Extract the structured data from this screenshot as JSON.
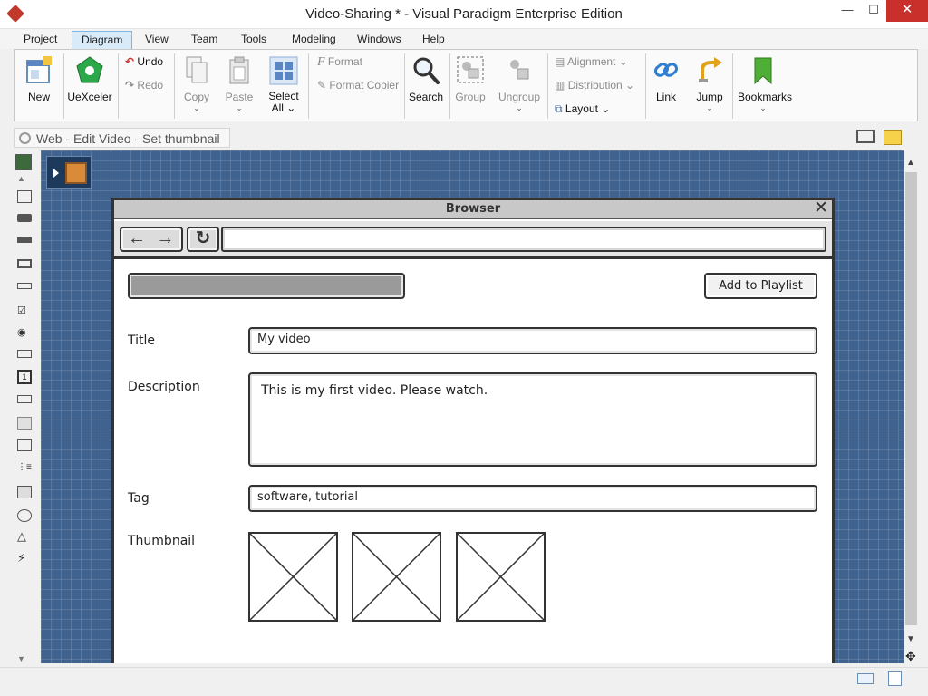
{
  "window": {
    "title": "Video-Sharing * - Visual Paradigm Enterprise Edition",
    "min_symbol": "—",
    "max_symbol": "☐",
    "close_symbol": "✕"
  },
  "menu": {
    "tabs": [
      "Project",
      "Diagram",
      "View",
      "Team",
      "Tools",
      "Modeling",
      "Windows",
      "Help"
    ],
    "active": "Diagram"
  },
  "ribbon": {
    "new": "New",
    "uexceler": "UeXceler",
    "undo": "Undo",
    "redo": "Redo",
    "copy": "Copy",
    "paste": "Paste",
    "select_all_1": "Select",
    "select_all_2": "All",
    "format": "Format",
    "format_copier": "Format Copier",
    "search": "Search",
    "group": "Group",
    "ungroup": "Ungroup",
    "alignment": "Alignment",
    "distribution": "Distribution",
    "layout": "Layout",
    "link": "Link",
    "jump": "Jump",
    "bookmarks": "Bookmarks"
  },
  "breadcrumb": {
    "label": "Web - Edit Video - Set thumbnail"
  },
  "wireframe": {
    "browser_title": "Browser",
    "add_button": "Add to Playlist",
    "title_label": "Title",
    "title_value": "My video",
    "description_label": "Description",
    "description_value": "This is my first video. Please watch.",
    "tag_label": "Tag",
    "tag_value": "software, tutorial",
    "thumbnail_label": "Thumbnail",
    "thumbnail_count": 3
  },
  "colors": {
    "canvas_bg": "#3f628f",
    "close_button": "#c9302c",
    "active_tab": "#d9ebf9"
  },
  "icons": [
    "app-logo-icon",
    "new-diagram-icon",
    "uexceler-icon",
    "undo-icon",
    "redo-icon",
    "copy-icon",
    "paste-icon",
    "select-all-icon",
    "format-icon",
    "format-copier-icon",
    "search-icon",
    "group-icon",
    "ungroup-icon",
    "alignment-icon",
    "distribution-icon",
    "layout-icon",
    "link-icon",
    "jump-icon",
    "bookmark-icon",
    "email-icon",
    "note-icon"
  ]
}
